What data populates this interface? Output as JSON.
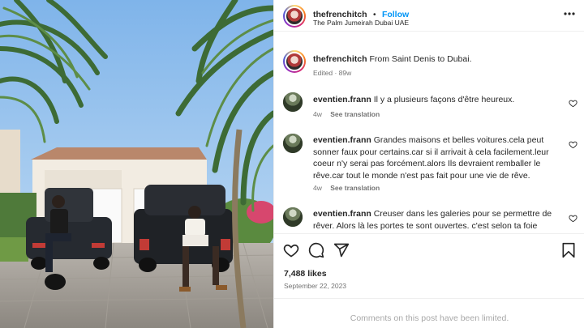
{
  "header": {
    "username": "thefrenchitch",
    "separator": "•",
    "follow_label": "Follow",
    "location": "The Palm Jumeirah Dubai UAE",
    "more_icon": "more-horizontal-icon"
  },
  "caption": {
    "username": "thefrenchitch",
    "text": "From Saint Denis to Dubai.",
    "meta": "Edited · 89w"
  },
  "comments": [
    {
      "username": "eventien.frann",
      "text": "Il y a plusieurs façons d'être heureux.",
      "age": "4w",
      "see_translation": "See translation"
    },
    {
      "username": "eventien.frann",
      "text": "Grandes maisons et belles voitures.cela peut sonner faux pour certains.car si il arrivait à cela facilement.leur coeur n'y serai pas forcément.alors Ils devraient remballer le rêve.car tout le monde n'est pas fait pour une vie de rêve.",
      "age": "4w",
      "see_translation": "See translation"
    },
    {
      "username": "eventien.frann",
      "text": "Creuser dans les galeries pour se permettre de rêver. Alors là les portes te sont ouvertes. c'est selon ta foie",
      "age": "",
      "see_translation": ""
    }
  ],
  "actions": {
    "likes": "7,488 likes",
    "date": "September 22, 2023",
    "icons": [
      "heart-icon",
      "comment-icon",
      "share-icon",
      "bookmark-icon"
    ]
  },
  "footer": {
    "limited_text": "Comments on this post have been limited."
  },
  "colors": {
    "accent": "#0095f6",
    "text": "#262626",
    "muted": "#737373",
    "divider": "#efefef"
  }
}
